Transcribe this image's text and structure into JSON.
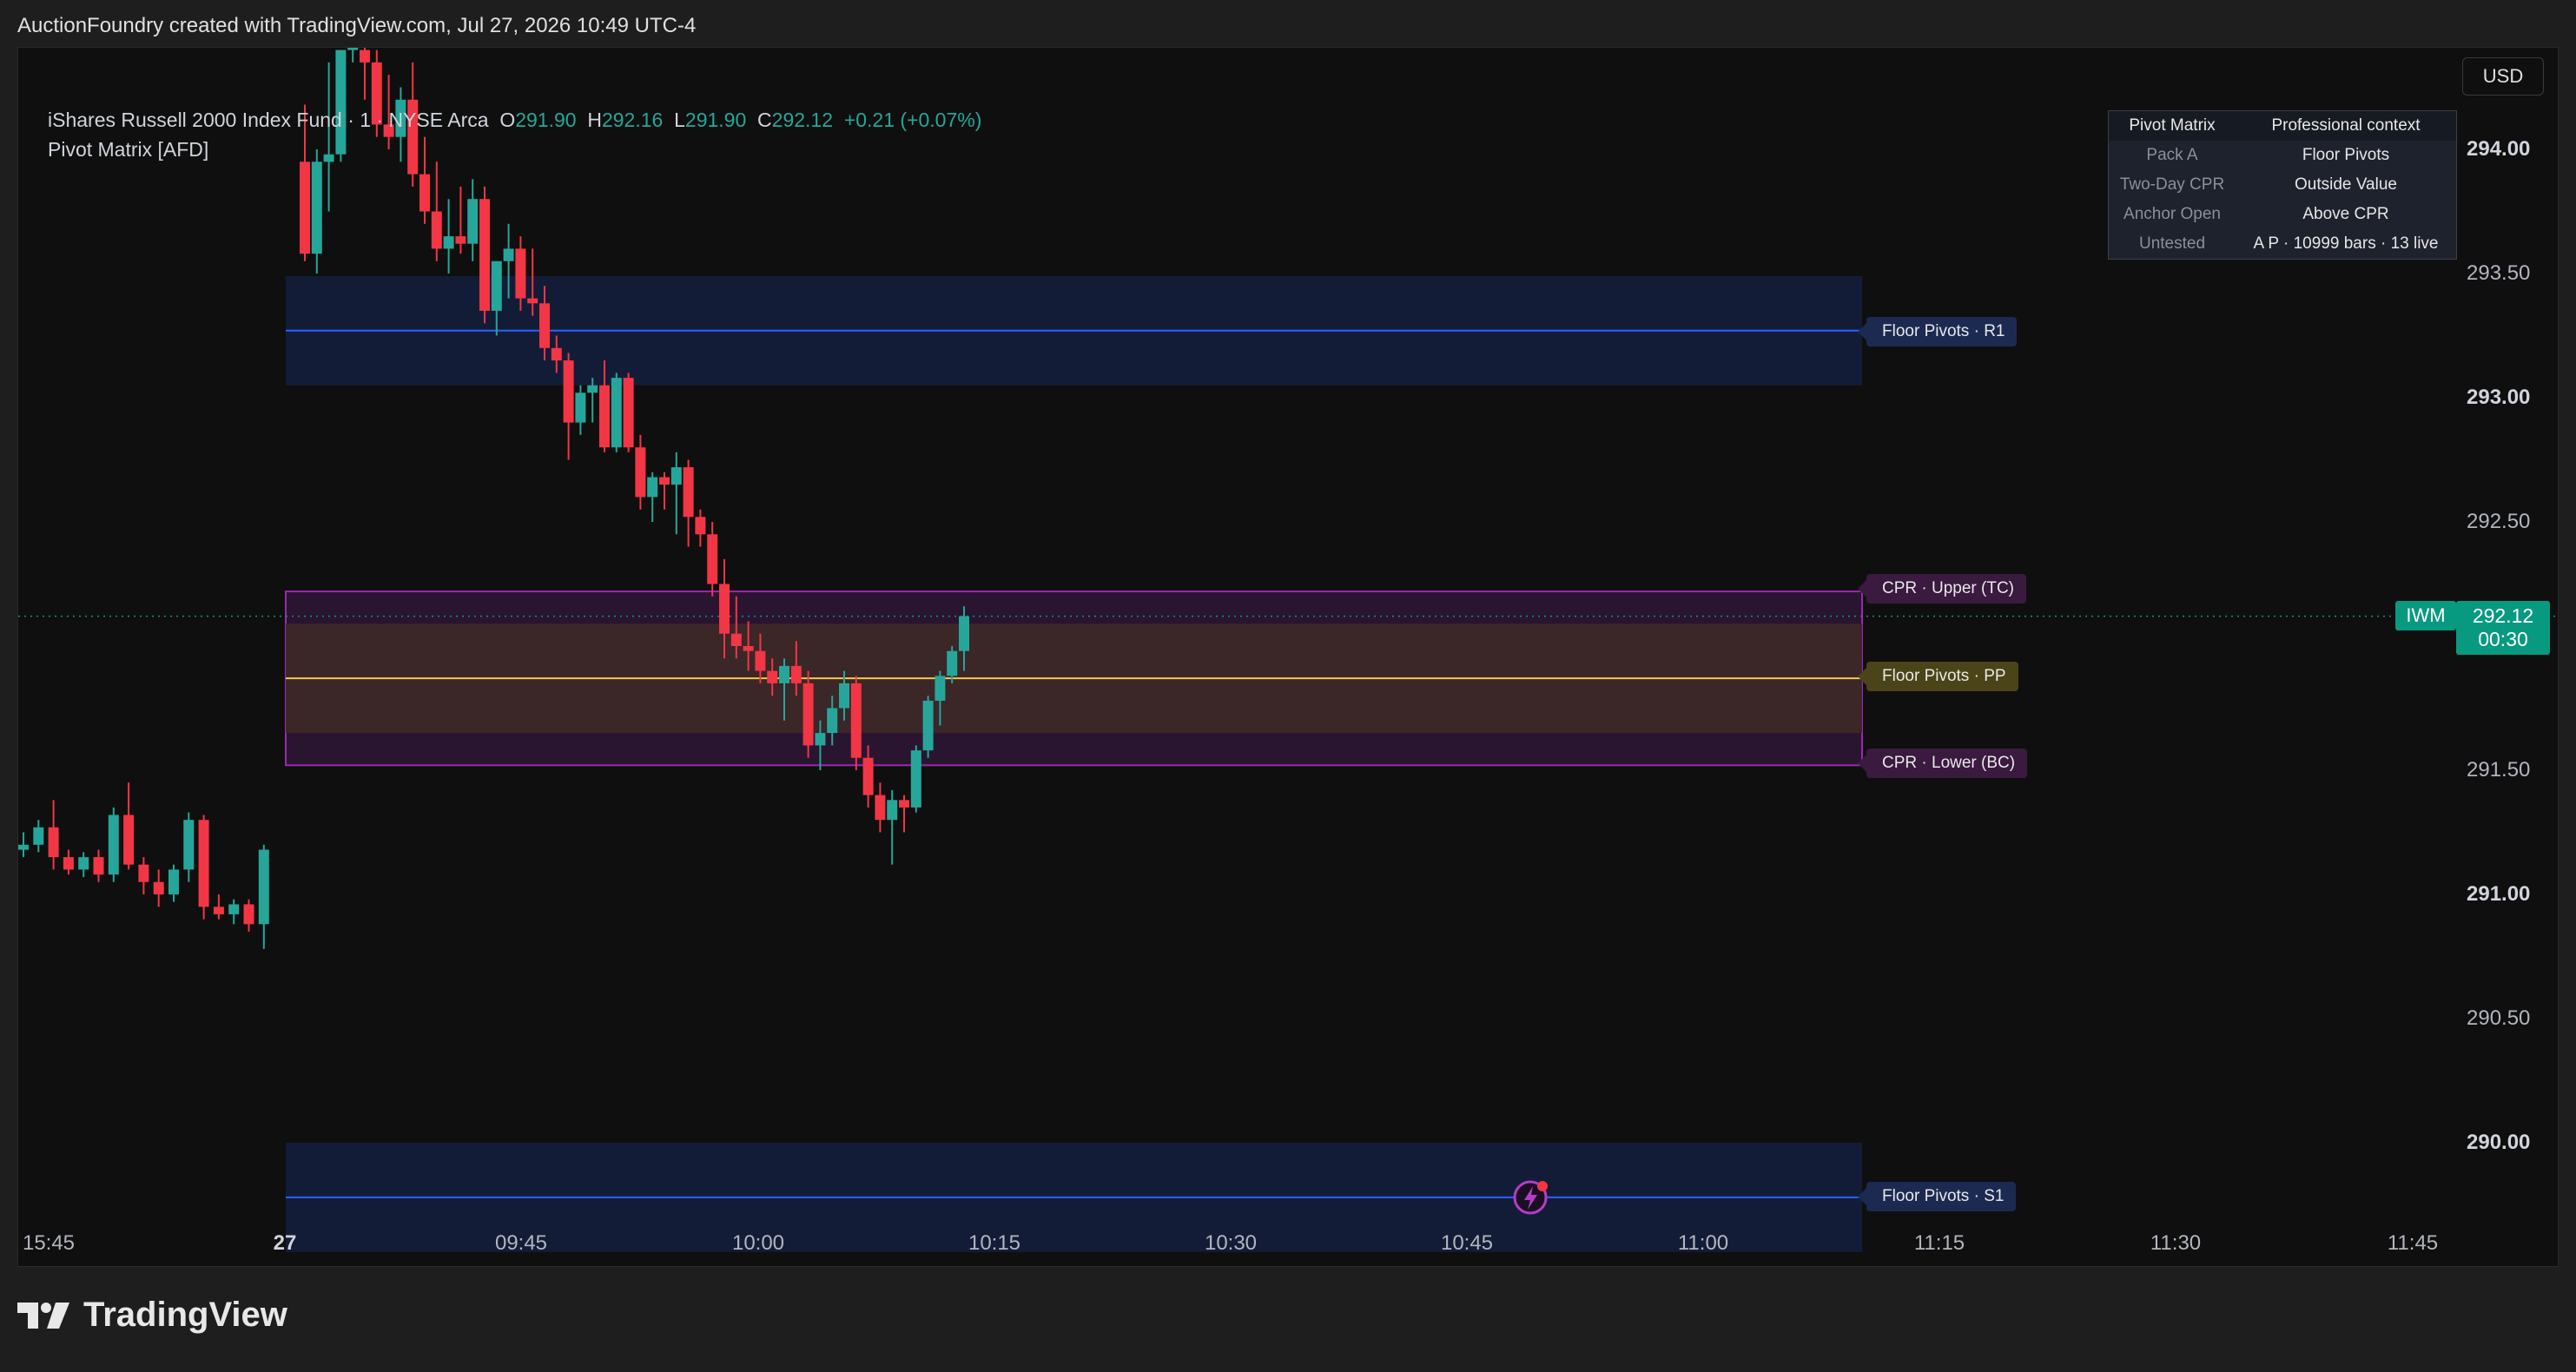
{
  "header": {
    "attribution": "AuctionFoundry created with TradingView.com, Jul 27, 2026 10:49 UTC-4"
  },
  "legend": {
    "symbol_desc": "iShares Russell 2000 Index Fund · 1 · NYSE Arca",
    "o_label": "O",
    "o_value": "291.90",
    "h_label": "H",
    "h_value": "292.16",
    "l_label": "L",
    "l_value": "291.90",
    "c_label": "C",
    "c_value": "292.12",
    "change": "+0.21 (+0.07%)",
    "indicator": "Pivot Matrix [AFD]"
  },
  "currency_button": "USD",
  "info_table": {
    "header": [
      "Pivot Matrix",
      "Professional context"
    ],
    "rows": [
      {
        "key": "Pack A",
        "value": "Floor Pivots"
      },
      {
        "key": "Two-Day CPR",
        "value": "Outside Value"
      },
      {
        "key": "Anchor Open",
        "value": "Above CPR"
      },
      {
        "key": "Untested",
        "value": "A P · 10999 bars · 13 live"
      }
    ]
  },
  "levels": {
    "r1": {
      "label": "Floor Pivots · R1",
      "price": 293.27,
      "zone": [
        293.05,
        293.49
      ],
      "color": "#2962ff"
    },
    "tc": {
      "label": "CPR · Upper (TC)",
      "price": 292.22,
      "color": "#9c27b0"
    },
    "pp": {
      "label": "Floor Pivots · PP",
      "price": 291.87,
      "zone": [
        291.65,
        292.09
      ],
      "color": "#f7c948"
    },
    "bc": {
      "label": "CPR · Lower (BC)",
      "price": 291.52,
      "color": "#9c27b0"
    },
    "s1": {
      "label": "Floor Pivots · S1",
      "price": 289.78,
      "zone": [
        289.56,
        290.0
      ],
      "color": "#2962ff"
    }
  },
  "price_axis": [
    "294.00",
    "293.50",
    "293.00",
    "292.50",
    "291.50",
    "291.00",
    "290.50",
    "290.00"
  ],
  "price_axis_bold": [
    "294.00",
    "293.00",
    "291.00",
    "290.00"
  ],
  "time_axis": [
    "15:45",
    "27",
    "09:45",
    "10:00",
    "10:15",
    "10:30",
    "10:45",
    "11:00",
    "11:15",
    "11:30",
    "11:45"
  ],
  "current_price": {
    "symbol": "IWM",
    "price": "292.12",
    "countdown": "00:30",
    "color": "#089981"
  },
  "colors": {
    "up": "#26a69a",
    "down": "#f23645",
    "background": "#0f0f0f"
  },
  "icons": {
    "alert": "lightning-alert-icon",
    "logo": "tradingview-logo-icon"
  },
  "brand": "TradingView",
  "chart_data": {
    "type": "candlestick",
    "symbol": "IWM",
    "timeframe": "1",
    "ylim": [
      289.6,
      294.4
    ],
    "candles": [
      {
        "o": 291.18,
        "h": 291.25,
        "l": 291.15,
        "c": 291.2
      },
      {
        "o": 291.2,
        "h": 291.3,
        "l": 291.17,
        "c": 291.27
      },
      {
        "o": 291.27,
        "h": 291.38,
        "l": 291.1,
        "c": 291.15
      },
      {
        "o": 291.15,
        "h": 291.18,
        "l": 291.08,
        "c": 291.1
      },
      {
        "o": 291.1,
        "h": 291.17,
        "l": 291.07,
        "c": 291.15
      },
      {
        "o": 291.15,
        "h": 291.18,
        "l": 291.05,
        "c": 291.08
      },
      {
        "o": 291.08,
        "h": 291.35,
        "l": 291.05,
        "c": 291.32
      },
      {
        "o": 291.32,
        "h": 291.45,
        "l": 291.1,
        "c": 291.12
      },
      {
        "o": 291.12,
        "h": 291.15,
        "l": 291.0,
        "c": 291.05
      },
      {
        "o": 291.05,
        "h": 291.1,
        "l": 290.95,
        "c": 291.0
      },
      {
        "o": 291.0,
        "h": 291.12,
        "l": 290.97,
        "c": 291.1
      },
      {
        "o": 291.1,
        "h": 291.33,
        "l": 291.05,
        "c": 291.3
      },
      {
        "o": 291.3,
        "h": 291.32,
        "l": 290.9,
        "c": 290.95
      },
      {
        "o": 290.95,
        "h": 291.0,
        "l": 290.9,
        "c": 290.92
      },
      {
        "o": 290.92,
        "h": 290.98,
        "l": 290.88,
        "c": 290.96
      },
      {
        "o": 290.96,
        "h": 290.98,
        "l": 290.85,
        "c": 290.88
      },
      {
        "o": 290.88,
        "h": 291.2,
        "l": 290.78,
        "c": 291.18
      },
      {
        "o": 293.95,
        "h": 294.18,
        "l": 293.55,
        "c": 293.58
      },
      {
        "o": 293.58,
        "h": 294.0,
        "l": 293.5,
        "c": 293.95
      },
      {
        "o": 293.95,
        "h": 294.35,
        "l": 293.75,
        "c": 293.98
      },
      {
        "o": 293.98,
        "h": 294.4,
        "l": 293.95,
        "c": 294.4
      },
      {
        "o": 294.4,
        "h": 294.45,
        "l": 294.35,
        "c": 294.42
      },
      {
        "o": 294.4,
        "h": 294.45,
        "l": 294.2,
        "c": 294.35
      },
      {
        "o": 294.35,
        "h": 294.4,
        "l": 294.05,
        "c": 294.1
      },
      {
        "o": 294.1,
        "h": 294.3,
        "l": 294.0,
        "c": 294.05
      },
      {
        "o": 294.05,
        "h": 294.25,
        "l": 293.95,
        "c": 294.2
      },
      {
        "o": 294.2,
        "h": 294.35,
        "l": 293.85,
        "c": 293.9
      },
      {
        "o": 293.9,
        "h": 294.05,
        "l": 293.7,
        "c": 293.75
      },
      {
        "o": 293.75,
        "h": 293.95,
        "l": 293.55,
        "c": 293.6
      },
      {
        "o": 293.6,
        "h": 293.8,
        "l": 293.5,
        "c": 293.65
      },
      {
        "o": 293.65,
        "h": 293.85,
        "l": 293.58,
        "c": 293.62
      },
      {
        "o": 293.62,
        "h": 293.88,
        "l": 293.55,
        "c": 293.8
      },
      {
        "o": 293.8,
        "h": 293.85,
        "l": 293.3,
        "c": 293.35
      },
      {
        "o": 293.35,
        "h": 293.55,
        "l": 293.25,
        "c": 293.55
      },
      {
        "o": 293.55,
        "h": 293.7,
        "l": 293.4,
        "c": 293.6
      },
      {
        "o": 293.6,
        "h": 293.65,
        "l": 293.35,
        "c": 293.4
      },
      {
        "o": 293.4,
        "h": 293.6,
        "l": 293.33,
        "c": 293.38
      },
      {
        "o": 293.38,
        "h": 293.45,
        "l": 293.15,
        "c": 293.2
      },
      {
        "o": 293.2,
        "h": 293.25,
        "l": 293.1,
        "c": 293.15
      },
      {
        "o": 293.15,
        "h": 293.18,
        "l": 292.75,
        "c": 292.9
      },
      {
        "o": 292.9,
        "h": 293.05,
        "l": 292.85,
        "c": 293.02
      },
      {
        "o": 293.02,
        "h": 293.08,
        "l": 292.9,
        "c": 293.05
      },
      {
        "o": 293.05,
        "h": 293.15,
        "l": 292.78,
        "c": 292.8
      },
      {
        "o": 292.8,
        "h": 293.1,
        "l": 292.78,
        "c": 293.08
      },
      {
        "o": 293.08,
        "h": 293.1,
        "l": 292.78,
        "c": 292.8
      },
      {
        "o": 292.8,
        "h": 292.85,
        "l": 292.55,
        "c": 292.6
      },
      {
        "o": 292.6,
        "h": 292.7,
        "l": 292.5,
        "c": 292.68
      },
      {
        "o": 292.68,
        "h": 292.7,
        "l": 292.55,
        "c": 292.65
      },
      {
        "o": 292.65,
        "h": 292.78,
        "l": 292.45,
        "c": 292.72
      },
      {
        "o": 292.72,
        "h": 292.75,
        "l": 292.4,
        "c": 292.52
      },
      {
        "o": 292.52,
        "h": 292.55,
        "l": 292.4,
        "c": 292.45
      },
      {
        "o": 292.45,
        "h": 292.5,
        "l": 292.2,
        "c": 292.25
      },
      {
        "o": 292.25,
        "h": 292.35,
        "l": 291.95,
        "c": 292.05
      },
      {
        "o": 292.05,
        "h": 292.2,
        "l": 291.95,
        "c": 292.0
      },
      {
        "o": 292.0,
        "h": 292.1,
        "l": 291.9,
        "c": 291.98
      },
      {
        "o": 291.98,
        "h": 292.05,
        "l": 291.85,
        "c": 291.9
      },
      {
        "o": 291.9,
        "h": 291.95,
        "l": 291.8,
        "c": 291.85
      },
      {
        "o": 291.85,
        "h": 291.95,
        "l": 291.7,
        "c": 291.92
      },
      {
        "o": 291.92,
        "h": 292.02,
        "l": 291.8,
        "c": 291.85
      },
      {
        "o": 291.85,
        "h": 291.9,
        "l": 291.55,
        "c": 291.6
      },
      {
        "o": 291.6,
        "h": 291.7,
        "l": 291.5,
        "c": 291.65
      },
      {
        "o": 291.65,
        "h": 291.8,
        "l": 291.6,
        "c": 291.75
      },
      {
        "o": 291.75,
        "h": 291.9,
        "l": 291.7,
        "c": 291.85
      },
      {
        "o": 291.85,
        "h": 291.88,
        "l": 291.5,
        "c": 291.55
      },
      {
        "o": 291.55,
        "h": 291.6,
        "l": 291.35,
        "c": 291.4
      },
      {
        "o": 291.4,
        "h": 291.45,
        "l": 291.25,
        "c": 291.3
      },
      {
        "o": 291.3,
        "h": 291.42,
        "l": 291.12,
        "c": 291.38
      },
      {
        "o": 291.38,
        "h": 291.4,
        "l": 291.25,
        "c": 291.35
      },
      {
        "o": 291.35,
        "h": 291.6,
        "l": 291.33,
        "c": 291.58
      },
      {
        "o": 291.58,
        "h": 291.8,
        "l": 291.55,
        "c": 291.78
      },
      {
        "o": 291.78,
        "h": 291.9,
        "l": 291.68,
        "c": 291.88
      },
      {
        "o": 291.88,
        "h": 292.0,
        "l": 291.85,
        "c": 291.98
      },
      {
        "o": 291.98,
        "h": 292.16,
        "l": 291.9,
        "c": 292.12
      }
    ]
  }
}
